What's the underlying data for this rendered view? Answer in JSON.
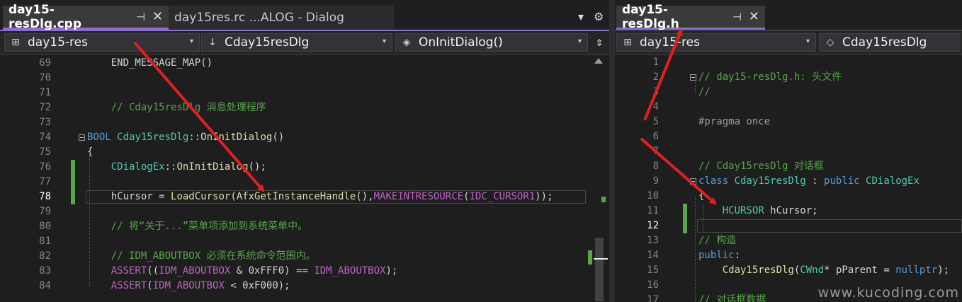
{
  "left": {
    "tabs": [
      {
        "label": "day15-resDlg.cpp",
        "active": true
      },
      {
        "label": "day15res.rc ...ALOG - Dialog",
        "active": false
      }
    ],
    "nav": {
      "project": "day15-res",
      "class_name": "Cday15resDlg",
      "member": "OnInitDialog()"
    }
  },
  "right": {
    "tabs": [
      {
        "label": "day15-resDlg.h",
        "active": true
      }
    ],
    "nav": {
      "project": "day15-res",
      "class_name": "Cday15resDlg"
    }
  },
  "icons": {
    "pin": "⊣",
    "close": "✕",
    "dropdown": "▾",
    "gear": "⚙",
    "split": "⇕",
    "project": "⊞",
    "class": "↓",
    "method": "◈",
    "class_alt": "◇"
  },
  "watermark": "www.kucoding.com",
  "colors": {
    "accent": "#8b6fd6",
    "arrow": "#e02020",
    "changed": "#57a64a"
  },
  "left_code": [
    {
      "n": "69",
      "parts": [
        {
          "c": "tx",
          "t": "    END_MESSAGE_MAP()"
        }
      ]
    },
    {
      "n": "70",
      "parts": []
    },
    {
      "n": "71",
      "parts": []
    },
    {
      "n": "72",
      "parts": [
        {
          "c": "cm",
          "t": "    // Cday15resDlg 消息处理程序"
        }
      ]
    },
    {
      "n": "73",
      "parts": []
    },
    {
      "n": "74",
      "parts": [
        {
          "c": "kw",
          "t": "BOOL "
        },
        {
          "c": "ty",
          "t": "Cday15resDlg"
        },
        {
          "c": "tx",
          "t": "::"
        },
        {
          "c": "fn",
          "t": "OnInitDialog"
        },
        {
          "c": "tx",
          "t": "()"
        }
      ]
    },
    {
      "n": "75",
      "parts": [
        {
          "c": "tx",
          "t": "{"
        }
      ]
    },
    {
      "n": "76",
      "parts": [
        {
          "c": "tx",
          "t": "    "
        },
        {
          "c": "ty",
          "t": "CDialogEx"
        },
        {
          "c": "tx",
          "t": "::"
        },
        {
          "c": "fn",
          "t": "OnInitDialog"
        },
        {
          "c": "tx",
          "t": "();"
        }
      ]
    },
    {
      "n": "77",
      "parts": []
    },
    {
      "n": "78",
      "parts": [
        {
          "c": "tx",
          "t": "    hCursor = "
        },
        {
          "c": "fn",
          "t": "LoadCursor"
        },
        {
          "c": "tx",
          "t": "("
        },
        {
          "c": "fn",
          "t": "AfxGetInstanceHandle"
        },
        {
          "c": "tx",
          "t": "(),"
        },
        {
          "c": "mc",
          "t": "MAKEINTRESOURCE"
        },
        {
          "c": "tx",
          "t": "("
        },
        {
          "c": "mc",
          "t": "IDC_CURSOR1"
        },
        {
          "c": "tx",
          "t": "));"
        }
      ]
    },
    {
      "n": "79",
      "parts": []
    },
    {
      "n": "80",
      "parts": [
        {
          "c": "cm",
          "t": "    // 将“关于...”菜单项添加到系统菜单中。"
        }
      ]
    },
    {
      "n": "81",
      "parts": []
    },
    {
      "n": "82",
      "parts": [
        {
          "c": "cm",
          "t": "    // IDM_ABOUTBOX 必须在系统命令范围内。"
        }
      ]
    },
    {
      "n": "83",
      "parts": [
        {
          "c": "tx",
          "t": "    "
        },
        {
          "c": "mc",
          "t": "ASSERT"
        },
        {
          "c": "tx",
          "t": "(("
        },
        {
          "c": "mc",
          "t": "IDM_ABOUTBOX"
        },
        {
          "c": "tx",
          "t": " & 0xFFF0) == "
        },
        {
          "c": "mc",
          "t": "IDM_ABOUTBOX"
        },
        {
          "c": "tx",
          "t": ");"
        }
      ]
    },
    {
      "n": "84",
      "parts": [
        {
          "c": "tx",
          "t": "    "
        },
        {
          "c": "mc",
          "t": "ASSERT"
        },
        {
          "c": "tx",
          "t": "("
        },
        {
          "c": "mc",
          "t": "IDM_ABOUTBOX"
        },
        {
          "c": "tx",
          "t": " < 0xF000);"
        }
      ]
    }
  ],
  "right_code": [
    {
      "n": "1",
      "parts": []
    },
    {
      "n": "2",
      "parts": [
        {
          "c": "cm",
          "t": "// day15-resDlg.h: 头文件"
        }
      ]
    },
    {
      "n": "3",
      "parts": [
        {
          "c": "cm",
          "t": "//"
        }
      ]
    },
    {
      "n": "4",
      "parts": []
    },
    {
      "n": "5",
      "parts": [
        {
          "c": "pp",
          "t": "#pragma once"
        }
      ]
    },
    {
      "n": "6",
      "parts": []
    },
    {
      "n": "7",
      "parts": []
    },
    {
      "n": "8",
      "parts": [
        {
          "c": "cm",
          "t": "// Cday15resDlg 对话框"
        }
      ]
    },
    {
      "n": "9",
      "parts": [
        {
          "c": "kw",
          "t": "class "
        },
        {
          "c": "ty",
          "t": "Cday15resDlg"
        },
        {
          "c": "tx",
          "t": " : "
        },
        {
          "c": "kw",
          "t": "public "
        },
        {
          "c": "ty",
          "t": "CDialogEx"
        }
      ]
    },
    {
      "n": "10",
      "parts": [
        {
          "c": "tx",
          "t": "{"
        }
      ]
    },
    {
      "n": "11",
      "parts": [
        {
          "c": "tx",
          "t": "    "
        },
        {
          "c": "ty",
          "t": "HCURSOR"
        },
        {
          "c": "tx",
          "t": " hCursor;"
        }
      ]
    },
    {
      "n": "12",
      "parts": []
    },
    {
      "n": "13",
      "parts": [
        {
          "c": "cm",
          "t": "// 构造"
        }
      ]
    },
    {
      "n": "14",
      "parts": [
        {
          "c": "kw",
          "t": "public"
        },
        {
          "c": "tx",
          "t": ":"
        }
      ]
    },
    {
      "n": "15",
      "parts": [
        {
          "c": "tx",
          "t": "    "
        },
        {
          "c": "fn",
          "t": "Cday15resDlg"
        },
        {
          "c": "tx",
          "t": "("
        },
        {
          "c": "ty",
          "t": "CWnd"
        },
        {
          "c": "tx",
          "t": "* pParent = "
        },
        {
          "c": "kw",
          "t": "nullptr"
        },
        {
          "c": "tx",
          "t": ");"
        }
      ]
    },
    {
      "n": "16",
      "parts": []
    },
    {
      "n": "17",
      "parts": [
        {
          "c": "cm",
          "t": "// 对话框数据"
        }
      ]
    }
  ]
}
